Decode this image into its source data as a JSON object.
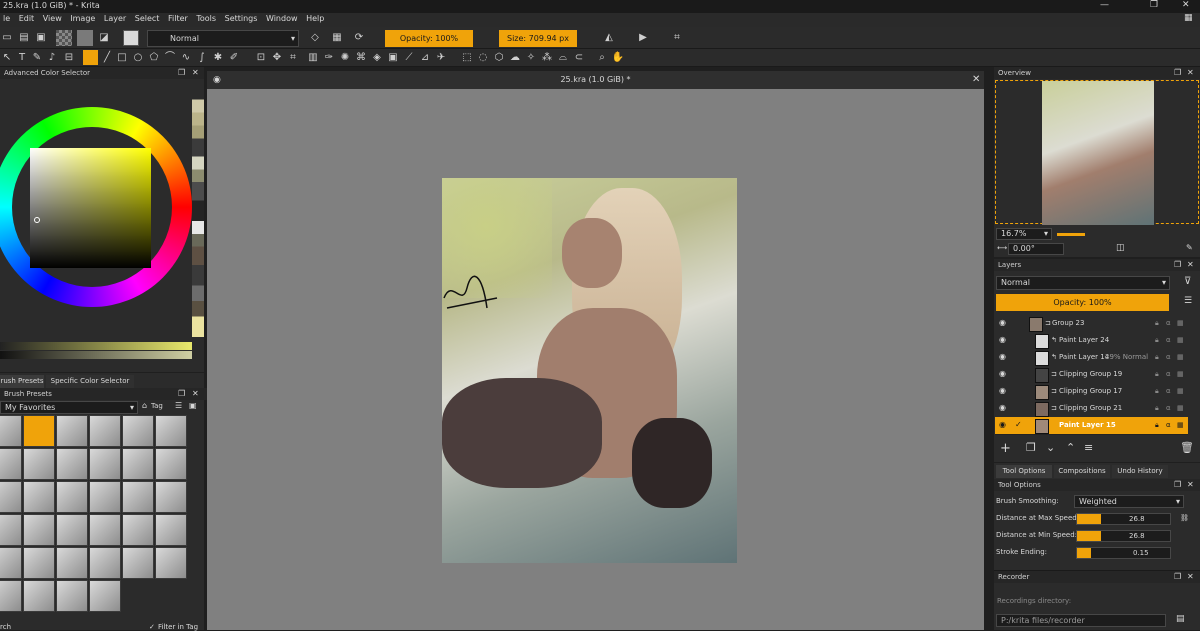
{
  "window": {
    "title": "25.kra (1.0 GiB) * - Krita"
  },
  "menu": [
    "le",
    "Edit",
    "View",
    "Image",
    "Layer",
    "Select",
    "Filter",
    "Tools",
    "Settings",
    "Window",
    "Help"
  ],
  "toolbar": {
    "blend_mode": "Normal",
    "opacity_label": "Opacity: 100%",
    "size_label": "Size: 709.94 px"
  },
  "document": {
    "tab_title": "25.kra (1.0 GiB) *"
  },
  "left_panels": {
    "color_selector_title": "Advanced Color Selector",
    "tabs": [
      "rush Presets",
      "Specific Color Selector"
    ],
    "brush_presets_title": "Brush Presets",
    "favorites": "My Favorites",
    "tag_label": "Tag",
    "filter_label": "Filter in Tag",
    "search_label": "rch"
  },
  "overview": {
    "title": "Overview",
    "zoom": "16.7%",
    "rotation": "0.00°"
  },
  "layers": {
    "title": "Layers",
    "blend_mode": "Normal",
    "opacity_label": "Opacity: 100%",
    "items": [
      {
        "name": "Group 23",
        "extra": ""
      },
      {
        "name": "Paint Layer 24",
        "extra": ""
      },
      {
        "name": "Paint Layer 14",
        "extra": "29% Normal"
      },
      {
        "name": "Clipping Group 19",
        "extra": ""
      },
      {
        "name": "Clipping Group 17",
        "extra": ""
      },
      {
        "name": "Clipping Group 21",
        "extra": ""
      },
      {
        "name": "Paint Layer 15",
        "extra": ""
      }
    ]
  },
  "tool_tabs": [
    "Tool Options",
    "Compositions",
    "Undo History"
  ],
  "tool_options": {
    "title": "Tool Options",
    "brush_smoothing_label": "Brush Smoothing:",
    "brush_smoothing_value": "Weighted",
    "dist_max_label": "Distance at Max Speed:",
    "dist_max_value": "26.8",
    "dist_min_label": "Distance at Min Speed:",
    "dist_min_value": "26.8",
    "stroke_end_label": "Stroke Ending:",
    "stroke_end_value": "0.15"
  },
  "recorder": {
    "title": "Recorder",
    "dir_label": "Recordings directory:",
    "dir_path": "P:/krita files/recorder"
  },
  "colors": {
    "accent": "#f0a30a",
    "canvas_bg": "#808080",
    "panel": "#2b2b2b"
  }
}
